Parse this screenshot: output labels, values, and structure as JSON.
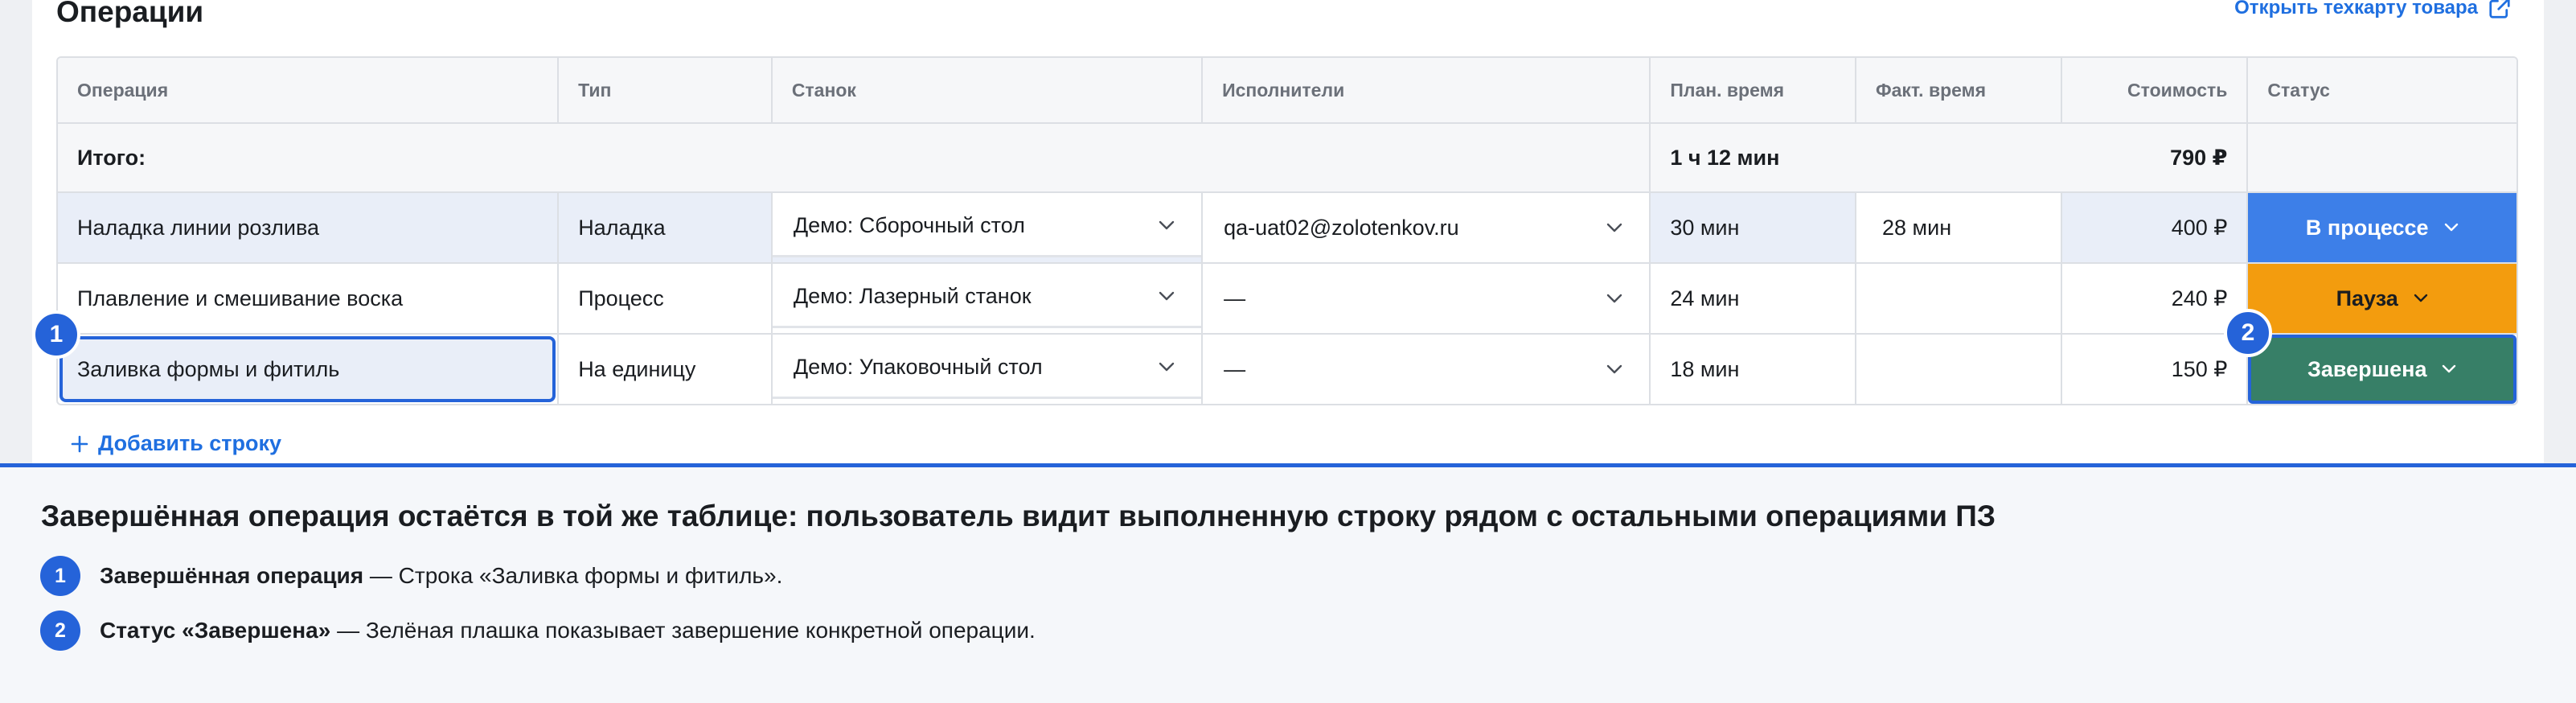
{
  "section": {
    "title": "Операции",
    "link_label": "Открыть техкарту товара",
    "link_icon": "external-link-icon"
  },
  "table": {
    "headers": [
      "Операция",
      "Тип",
      "Станок",
      "Исполнители",
      "План. время",
      "Факт. время",
      "Стоимость",
      "Статус"
    ],
    "total": {
      "label": "Итого:",
      "plan_time": "1 ч 12 мин",
      "cost": "790 ₽"
    },
    "rows": [
      {
        "operation": "Наладка линии розлива",
        "type": "Наладка",
        "machine": "Демо: Сборочный стол",
        "executor": "qa-uat02@zolotenkov.ru",
        "plan_time": "30 мин",
        "fact_time": "28 мин",
        "cost": "400 ₽",
        "status": "В процессе"
      },
      {
        "operation": "Плавление и смешивание воска",
        "type": "Процесс",
        "machine": "Демо: Лазерный станок",
        "executor": "—",
        "plan_time": "24 мин",
        "fact_time": "",
        "cost": "240 ₽",
        "status": "Пауза"
      },
      {
        "operation": "Заливка формы и фитиль",
        "type": "На единицу",
        "machine": "Демо: Упаковочный стол",
        "executor": "—",
        "plan_time": "18 мин",
        "fact_time": "",
        "cost": "150 ₽",
        "status": "Завершена"
      }
    ],
    "add_row_label": "Добавить строку"
  },
  "status_colors": {
    "in_progress": "#3d7fe8",
    "paused": "#f39c0e",
    "done": "#377f67",
    "accent": "#2563d9"
  },
  "markers": [
    "1",
    "2"
  ],
  "notes": {
    "title": "Завершённая операция остаётся в той же таблице: пользователь видит выполненную строку рядом с остальными операциями ПЗ",
    "items": [
      {
        "num": "1",
        "bold": "Завершённая операция",
        "text": " — Строка «Заливка формы и фитиль»."
      },
      {
        "num": "2",
        "bold": "Статус «Завершена»",
        "text": " — Зелёная плашка показывает завершение конкретной операции."
      }
    ]
  }
}
